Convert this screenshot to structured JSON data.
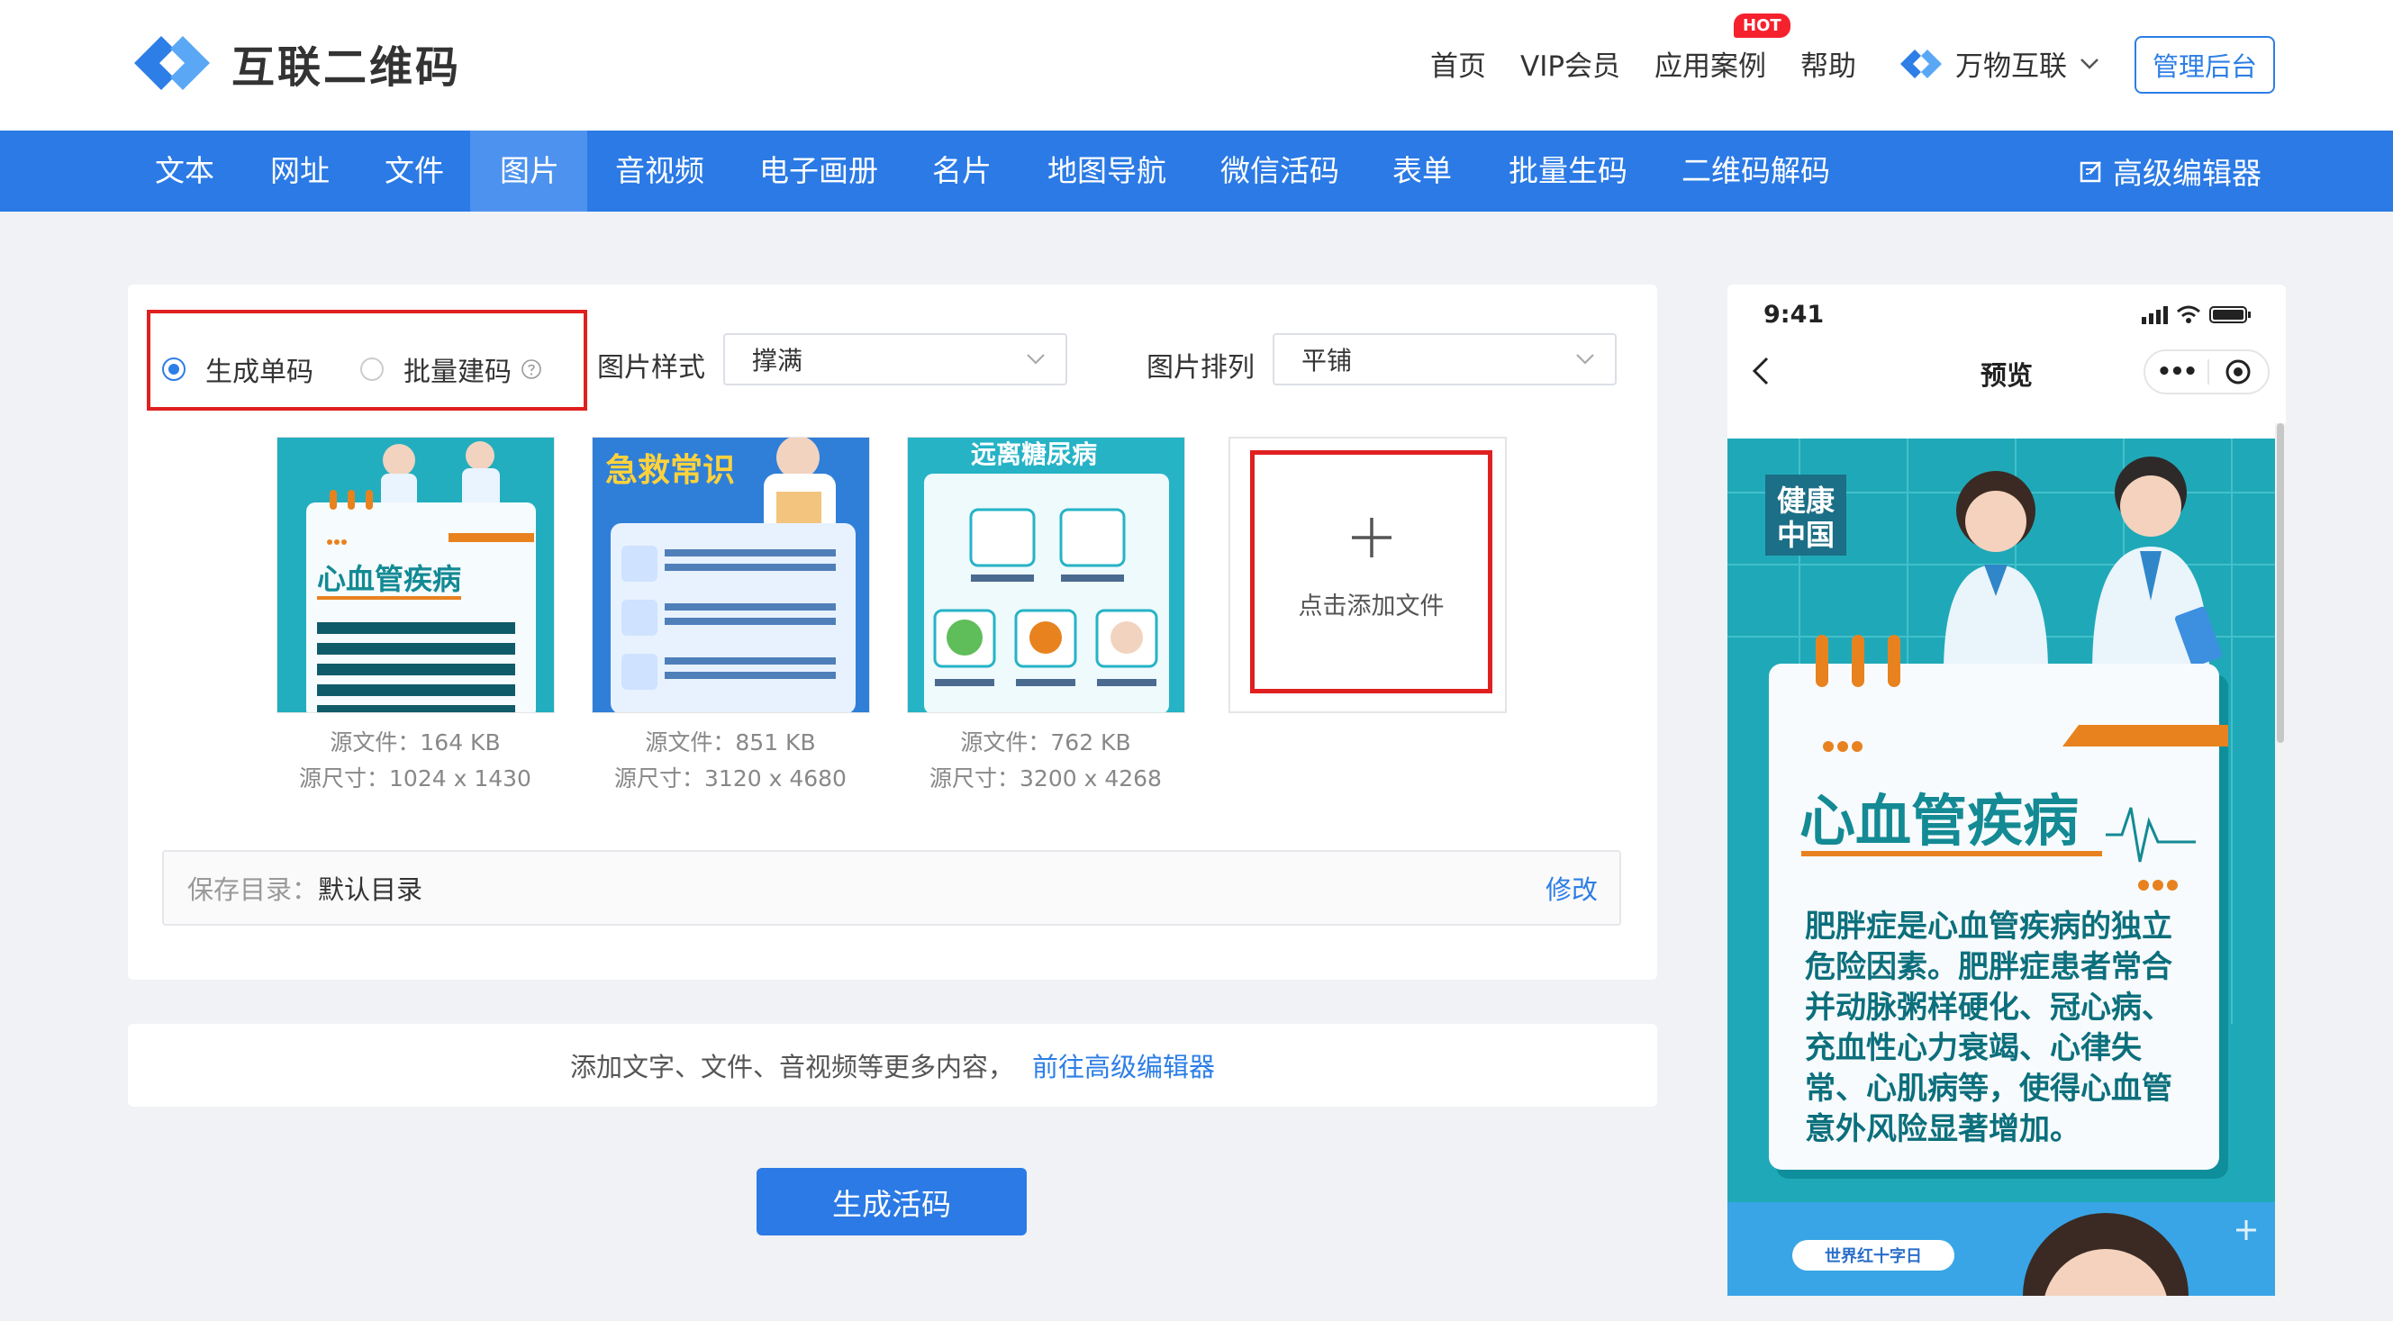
{
  "brand": {
    "name": "互联二维码"
  },
  "topnav": {
    "items": [
      "首页",
      "VIP会员",
      "应用案例",
      "帮助"
    ],
    "hot_badge": "HOT",
    "org": "万物互联",
    "admin": "管理后台"
  },
  "menu": {
    "items": [
      "文本",
      "网址",
      "文件",
      "图片",
      "音视频",
      "电子画册",
      "名片",
      "地图导航",
      "微信活码",
      "表单",
      "批量生码",
      "二维码解码"
    ],
    "active": "图片",
    "advanced_editor": "高级编辑器"
  },
  "options": {
    "single": "生成单码",
    "batch": "批量建码",
    "style_label": "图片样式",
    "style_value": "撑满",
    "layout_label": "图片排列",
    "layout_value": "平铺"
  },
  "images": [
    {
      "size": "源文件：164 KB",
      "dims": "源尺寸：1024 x 1430",
      "banner": "",
      "title": "心血管疾病"
    },
    {
      "size": "源文件：851 KB",
      "dims": "源尺寸：3120 x 4680",
      "banner": "急救常识",
      "title": ""
    },
    {
      "size": "源文件：762 KB",
      "dims": "源尺寸：3200 x 4268",
      "banner": "远离糖尿病",
      "title": ""
    }
  ],
  "add_file": "点击添加文件",
  "save": {
    "label": "保存目录：",
    "value": "默认目录",
    "edit": "修改"
  },
  "more": {
    "text": "添加文字、文件、音视频等更多内容，",
    "link": "前往高级编辑器"
  },
  "generate": "生成活码",
  "preview": {
    "time": "9:41",
    "title": "预览",
    "more": "•••",
    "poster_badge": "健康中国",
    "poster_title": "心血管疾病",
    "poster_body": [
      "肥胖症是心血管疾病的独立",
      "危险因素。肥胖症患者常合",
      "并动脉粥样硬化、冠心病、",
      "充血性心力衰竭、心律失",
      "常、心肌病等，使得心血管",
      "意外风险显著增加。"
    ],
    "poster2_label": "世界红十字日"
  },
  "colors": {
    "primary": "#2b7ae5",
    "accent_red": "#e02020",
    "poster_teal": "#1fa9b8"
  }
}
